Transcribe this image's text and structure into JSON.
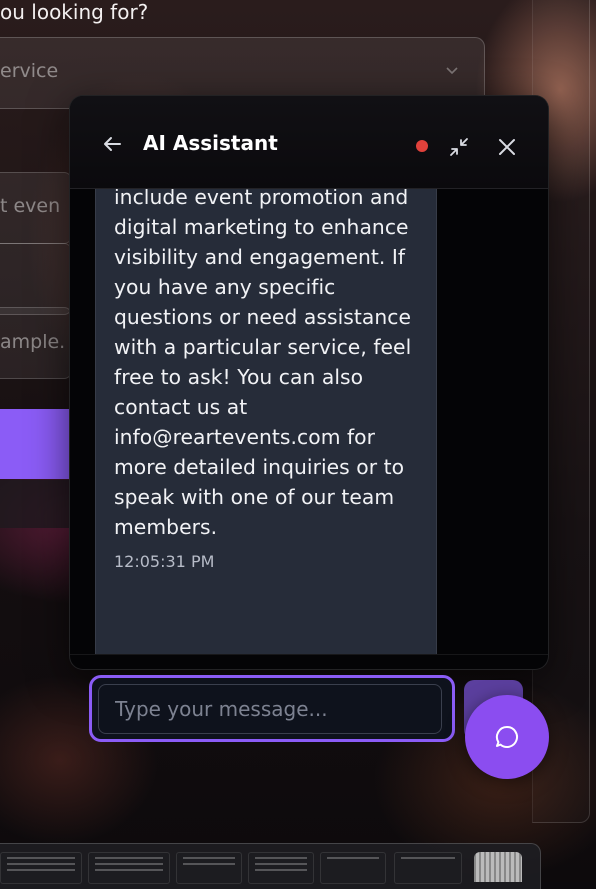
{
  "page": {
    "question_fragment": "ou looking for?",
    "service_select_value": "ervice",
    "field_2_placeholder": "t even",
    "field_4_placeholder": "ample."
  },
  "chat": {
    "title": "AI Assistant",
    "status_color": "#e0413b",
    "message_text": "include event promotion and digital marketing to enhance visibility and engagement. If you have any specific questions or need assistance with a particular service, feel free to ask! You can also contact us at info@reartevents.com for more detailed inquiries or to speak with one of our team members.",
    "message_time": "12:05:31 PM",
    "input_placeholder": "Type your message..."
  },
  "colors": {
    "accent": "#8b5cf6",
    "bubble": "#262c39",
    "status_dot": "#e0413b"
  },
  "icons": {
    "back": "arrow-left-icon",
    "minimize": "minimize-icon",
    "close": "close-icon",
    "send": "send-icon",
    "chat_toggle": "chat-bubble-icon"
  }
}
